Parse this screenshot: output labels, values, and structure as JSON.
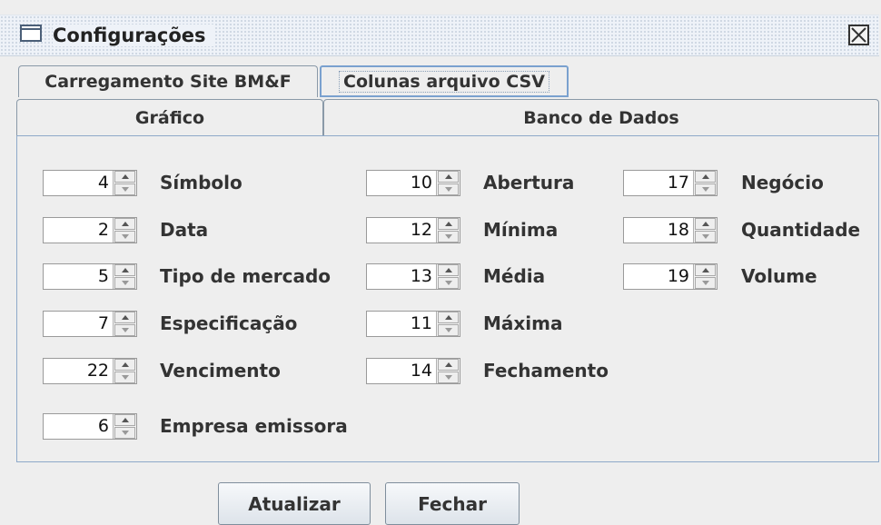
{
  "window": {
    "title": "Configurações"
  },
  "tabs_row1": [
    {
      "label": "Carregamento Site BM&F",
      "active": false
    },
    {
      "label": "Colunas arquivo CSV",
      "active": true
    }
  ],
  "tabs_row2": [
    {
      "label": "Gráfico",
      "active": false
    },
    {
      "label": "Banco de Dados",
      "active": false
    }
  ],
  "fields": [
    {
      "value": "4",
      "label": "Símbolo"
    },
    {
      "value": "2",
      "label": "Data"
    },
    {
      "value": "5",
      "label": "Tipo de mercado"
    },
    {
      "value": "7",
      "label": "Especificação"
    },
    {
      "value": "22",
      "label": "Vencimento"
    },
    {
      "value": "6",
      "label": "Empresa emissora"
    },
    {
      "value": "10",
      "label": "Abertura"
    },
    {
      "value": "12",
      "label": "Mínima"
    },
    {
      "value": "13",
      "label": "Média"
    },
    {
      "value": "11",
      "label": "Máxima"
    },
    {
      "value": "14",
      "label": "Fechamento"
    },
    {
      "value": "17",
      "label": "Negócio"
    },
    {
      "value": "18",
      "label": "Quantidade"
    },
    {
      "value": "19",
      "label": "Volume"
    }
  ],
  "buttons": {
    "update": "Atualizar",
    "close": "Fechar"
  },
  "colors": {
    "tab_active_border": "#7aa1cf",
    "panel_border": "#8ea9c9",
    "background": "#eeeeee"
  },
  "icons": {
    "window": "window-icon",
    "close": "close-x-icon"
  }
}
